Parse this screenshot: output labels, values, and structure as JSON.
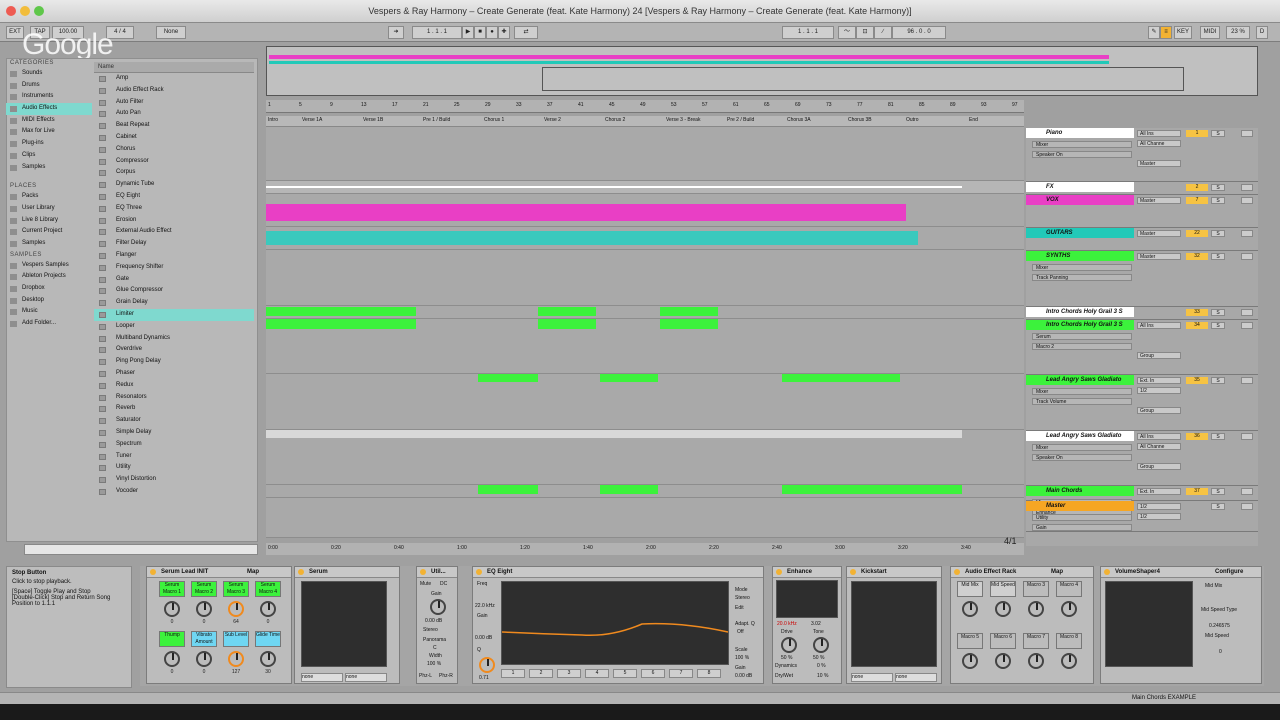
{
  "window": {
    "title": "Vespers & Ray Harmony – Create Generate (feat. Kate Harmony) 24  [Vespers & Ray Harmony – Create Generate (feat. Kate Harmony)]"
  },
  "watermark": "Google",
  "controlbar": {
    "ext": "EXT",
    "tap": "TAP",
    "tempo": "100.00",
    "signature": "4 / 4",
    "quantize": "None",
    "position": "1 . 1 . 1",
    "position2": "1 . 1 . 1",
    "loop_length": "96 . 0 . 0",
    "key": "KEY",
    "midi": "MIDI",
    "cpu": "23 %"
  },
  "browser": {
    "categories_title": "CATEGORIES",
    "categories": [
      "Sounds",
      "Drums",
      "Instruments",
      "Audio Effects",
      "MIDI Effects",
      "Max for Live",
      "Plug-ins",
      "Clips",
      "Samples"
    ],
    "places_title": "PLACES",
    "places": [
      "Packs",
      "User Library",
      "Live 8 Library",
      "Current Project",
      "Samples"
    ],
    "samples_title": "SAMPLES",
    "samples": [
      "Vespers Samples",
      "Ableton Projects",
      "Dropbox",
      "Desktop",
      "Music",
      "Add Folder..."
    ],
    "name_header": "Name",
    "items": [
      "Amp",
      "Audio Effect Rack",
      "Auto Filter",
      "Auto Pan",
      "Beat Repeat",
      "Cabinet",
      "Chorus",
      "Compressor",
      "Corpus",
      "Dynamic Tube",
      "EQ Eight",
      "EQ Three",
      "Erosion",
      "External Audio Effect",
      "Filter Delay",
      "Flanger",
      "Frequency Shifter",
      "Gate",
      "Glue Compressor",
      "Grain Delay",
      "Limiter",
      "Looper",
      "Multiband Dynamics",
      "Overdrive",
      "Ping Pong Delay",
      "Phaser",
      "Redux",
      "Resonators",
      "Reverb",
      "Saturator",
      "Simple Delay",
      "Spectrum",
      "Tuner",
      "Utility",
      "Vinyl Distortion",
      "Vocoder"
    ]
  },
  "arrangement": {
    "bars": [
      "1",
      "5",
      "9",
      "13",
      "17",
      "21",
      "25",
      "29",
      "33",
      "37",
      "41",
      "45",
      "49",
      "53",
      "57",
      "61",
      "65",
      "69",
      "73",
      "77",
      "81",
      "85",
      "89",
      "93",
      "97"
    ],
    "locators": [
      "Intro",
      "Verse 1A",
      "Verse 1B",
      "Pre 1 / Build",
      "Chorus 1",
      "Verse 2",
      "Chorus 2",
      "Verse 3 - Break",
      "Pre 2 / Build",
      "Chorus 3A",
      "Chorus 3B",
      "Outro",
      "End"
    ],
    "times": [
      "0:00",
      "0:20",
      "0:40",
      "1:00",
      "1:20",
      "1:40",
      "2:00",
      "2:20",
      "2:40",
      "3:00",
      "3:20",
      "3:40"
    ],
    "scroll_info": "4/1"
  },
  "tracks": [
    {
      "name": "Piano",
      "color": "#ffffff",
      "io": "All Ins",
      "num": "1",
      "sub1": "Mixer",
      "sub2": "Speaker On",
      "io2": "All Channe",
      "out": "Master"
    },
    {
      "name": "FX",
      "color": "#ffffff",
      "num": "2"
    },
    {
      "name": "VOX",
      "color": "#e93fc5",
      "io": "Master",
      "num": "7"
    },
    {
      "name": "GUITARS",
      "color": "#22c9b8",
      "io": "Master",
      "num": "22"
    },
    {
      "name": "SYNTHS",
      "color": "#3cf23c",
      "io": "Master",
      "num": "32",
      "sub1": "Mixer",
      "sub2": "Track Panning"
    },
    {
      "name": "Intro Chords Holy Grail 3 S",
      "color": "#ffffff",
      "num": "33"
    },
    {
      "name": "Intro Chords Holy Grail 3 S",
      "color": "#3cf23c",
      "io": "All Ins",
      "num": "34",
      "sub1": "Serum",
      "sub2": "Macro 2",
      "out": "Group"
    },
    {
      "name": "Lead Angry Saws Gladiato",
      "color": "#3cf23c",
      "io": "Ext. In",
      "num": "35",
      "sub1": "Mixer",
      "sub2": "Track Volume",
      "io2": "1/2",
      "out": "Group"
    },
    {
      "name": "Lead Angry Saws Gladiato",
      "color": "#ffffff",
      "io": "All Ins",
      "num": "36",
      "sub1": "Mixer",
      "sub2": "Speaker On",
      "io2": "All Channe",
      "out": "Group"
    },
    {
      "name": "Main Chords",
      "color": "#3cf23c",
      "io": "Ext. In",
      "num": "37",
      "sub1": "Mixer",
      "sub2": "Enhance"
    },
    {
      "name": "Master",
      "color": "#f6a623",
      "io": "1/2",
      "io2": "1/2",
      "sub1": "Utility",
      "sub2": "Gain"
    }
  ],
  "info": {
    "title": "Stop Button",
    "text1": "Click to stop playback.",
    "text2": "[Space] Toggle Play and Stop",
    "text3": "[Double-Click] Stop and Return Song Position to 1.1.1"
  },
  "devices": {
    "serum_rack": {
      "title": "Serum Lead INIT",
      "map": "Map",
      "macros": [
        "Serum Macro 1",
        "Serum Macro 2",
        "Serum Macro 3",
        "Serum Macro 4",
        "Thump",
        "Vibrato Amount",
        "Sub Level",
        "Glide Time"
      ],
      "values": [
        "0",
        "0",
        "64",
        "0",
        "0",
        "0",
        "127",
        "30"
      ]
    },
    "serum": {
      "title": "Serum",
      "sel1": "none",
      "sel2": "none"
    },
    "utility": {
      "title": "Util...",
      "mute": "Mute",
      "dc": "DC",
      "gain_label": "Gain",
      "gain": "0.00 dB",
      "stereo": "Stereo",
      "panorama": "Panorama",
      "pan": "C",
      "width_label": "Width",
      "width": "100 %",
      "phz_l": "Phz-L",
      "phz_r": "Phz-R"
    },
    "eq": {
      "title": "EQ Eight",
      "freq_label": "Freq",
      "freq": "22.0 kHz",
      "gain_label": "Gain",
      "gain": "0.00 dB",
      "q_label": "Q",
      "q": "0.71",
      "mode_label": "Mode",
      "mode": "Stereo",
      "edit_label": "Edit",
      "adapt_label": "Adapt. Q",
      "adapt": "Off",
      "scale_label": "Scale",
      "scale": "100 %",
      "gain2_label": "Gain",
      "gain2": "0.00 dB",
      "bands": [
        "1",
        "2",
        "3",
        "4",
        "5",
        "6",
        "7",
        "8"
      ]
    },
    "enhance": {
      "title": "Enhance",
      "freq": "20.0 kHz",
      "q": "3.02",
      "drive_label": "Drive",
      "drive": "50 %",
      "tone_label": "Tone",
      "tone": "50 %",
      "dynamics_label": "Dynamics",
      "dynamics": "0 %",
      "drywet_label": "Dry/Wet",
      "drywet": "10 %"
    },
    "kickstart": {
      "title": "Kickstart",
      "sel1": "none",
      "sel2": "none"
    },
    "audio_rack": {
      "title": "Audio Effect Rack",
      "map": "Map",
      "macros": [
        "Mid Mix",
        "Mid Speed",
        "Macro 3",
        "Macro 4",
        "Macro 5",
        "Macro 6",
        "Macro 7",
        "Macro 8"
      ]
    },
    "volumeshaper": {
      "title": "VolumeShaper4",
      "configure": "Configure",
      "mid_mix": "Mid Mix",
      "mid_speed_type": "Mid Speed Type",
      "speed_value": "0.246575",
      "mid_speed": "Mid Speed",
      "mid_speed_value": "0"
    }
  },
  "statusbar": {
    "right": "Main Chords EXAMPLE"
  }
}
